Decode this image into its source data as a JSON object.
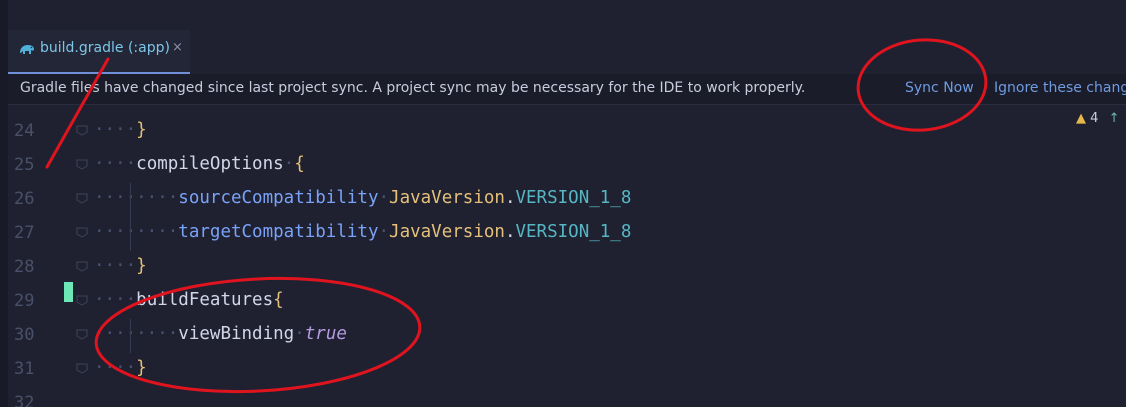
{
  "tab": {
    "label": "build.gradle (:app)",
    "close_glyph": "×",
    "icon": "gradle-elephant-icon"
  },
  "notification": {
    "message": "Gradle files have changed since last project sync. A project sync may be necessary for the IDE to work properly.",
    "sync_now": "Sync Now",
    "ignore": "Ignore these change"
  },
  "warnings": {
    "count": "4",
    "icon": "warning-icon"
  },
  "lines": [
    {
      "no": "24",
      "indent": "····",
      "parts": [
        {
          "t": "}",
          "c": "brace"
        }
      ]
    },
    {
      "no": "25",
      "indent": "····",
      "parts": [
        {
          "t": "compileOptions",
          "c": "plain"
        },
        {
          "t": "·",
          "c": "dots"
        },
        {
          "t": "{",
          "c": "brace"
        }
      ]
    },
    {
      "no": "26",
      "indent": "········",
      "parts": [
        {
          "t": "sourceCompatibility",
          "c": "kw-blue"
        },
        {
          "t": "·",
          "c": "dots"
        },
        {
          "t": "JavaVersion",
          "c": "kw-yellow"
        },
        {
          "t": ".",
          "c": "plain"
        },
        {
          "t": "VERSION_1_8",
          "c": "kw-cyan"
        }
      ]
    },
    {
      "no": "27",
      "indent": "········",
      "parts": [
        {
          "t": "targetCompatibility",
          "c": "kw-blue"
        },
        {
          "t": "·",
          "c": "dots"
        },
        {
          "t": "JavaVersion",
          "c": "kw-yellow"
        },
        {
          "t": ".",
          "c": "plain"
        },
        {
          "t": "VERSION_1_8",
          "c": "kw-cyan"
        }
      ]
    },
    {
      "no": "28",
      "indent": "····",
      "parts": [
        {
          "t": "}",
          "c": "brace"
        }
      ]
    },
    {
      "no": "29",
      "indent": "····",
      "parts": [
        {
          "t": "buildFeatures",
          "c": "plain"
        },
        {
          "t": "{",
          "c": "brace"
        }
      ]
    },
    {
      "no": "30",
      "indent": "········",
      "parts": [
        {
          "t": "viewBinding",
          "c": "plain"
        },
        {
          "t": "·",
          "c": "dots"
        },
        {
          "t": "true",
          "c": "kw-italic"
        }
      ]
    },
    {
      "no": "31",
      "indent": "····",
      "parts": [
        {
          "t": "}",
          "c": "brace"
        }
      ]
    },
    {
      "no": "32",
      "indent": "",
      "parts": []
    }
  ],
  "colors": {
    "background": "#1f2131",
    "accent": "#6f8fd8",
    "annotation_red": "#e0141e",
    "caret": "#6ee7b7"
  }
}
